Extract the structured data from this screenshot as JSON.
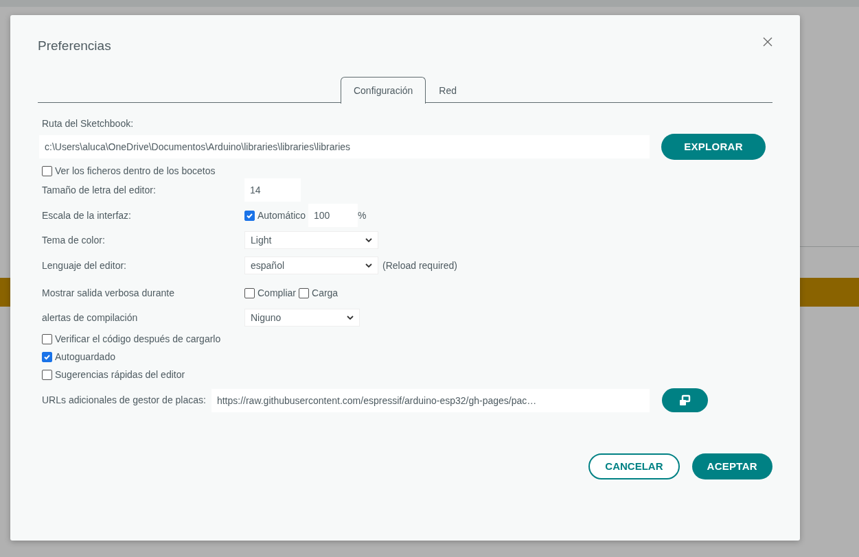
{
  "dialog": {
    "title": "Preferencias",
    "tabs": [
      {
        "label": "Configuración",
        "selected": true
      },
      {
        "label": "Red",
        "selected": false
      }
    ],
    "sketchbook": {
      "label": "Ruta del Sketchbook:",
      "value": "c:\\Users\\aluca\\OneDrive\\Documentos\\Arduino\\libraries\\libraries\\libraries",
      "button": "EXPLORAR"
    },
    "show_files": {
      "label": "Ver los ficheros dentro de los bocetos",
      "checked": false
    },
    "font_size": {
      "label": "Tamaño de letra del editor:",
      "value": "14"
    },
    "interface_scale": {
      "label": "Escala de la interfaz:",
      "auto": {
        "label": "Automático",
        "checked": true
      },
      "value": "100",
      "unit": "%"
    },
    "theme": {
      "label": "Tema de color:",
      "value": "Light"
    },
    "language": {
      "label": "Lenguaje del editor:",
      "value": "español",
      "note": "(Reload required)"
    },
    "verbose": {
      "label": "Mostrar salida verbosa durante",
      "options": [
        {
          "label": "Compliar",
          "checked": false
        },
        {
          "label": "Carga",
          "checked": false
        }
      ]
    },
    "warnings": {
      "label": "alertas de compilación",
      "value": "Niguno"
    },
    "checkboxes": [
      {
        "label": "Verificar el código después de cargarlo",
        "checked": false
      },
      {
        "label": "Autoguardado",
        "checked": true
      },
      {
        "label": "Sugerencias rápidas del editor",
        "checked": false
      }
    ],
    "board_urls": {
      "label": "URLs adicionales de gestor de placas:",
      "value": "https://raw.githubusercontent.com/espressif/arduino-esp32/gh-pages/pac…"
    },
    "buttons": [
      {
        "label": "CANCELAR",
        "kind": "outline"
      },
      {
        "label": "ACEPTAR",
        "kind": "primary"
      }
    ]
  }
}
